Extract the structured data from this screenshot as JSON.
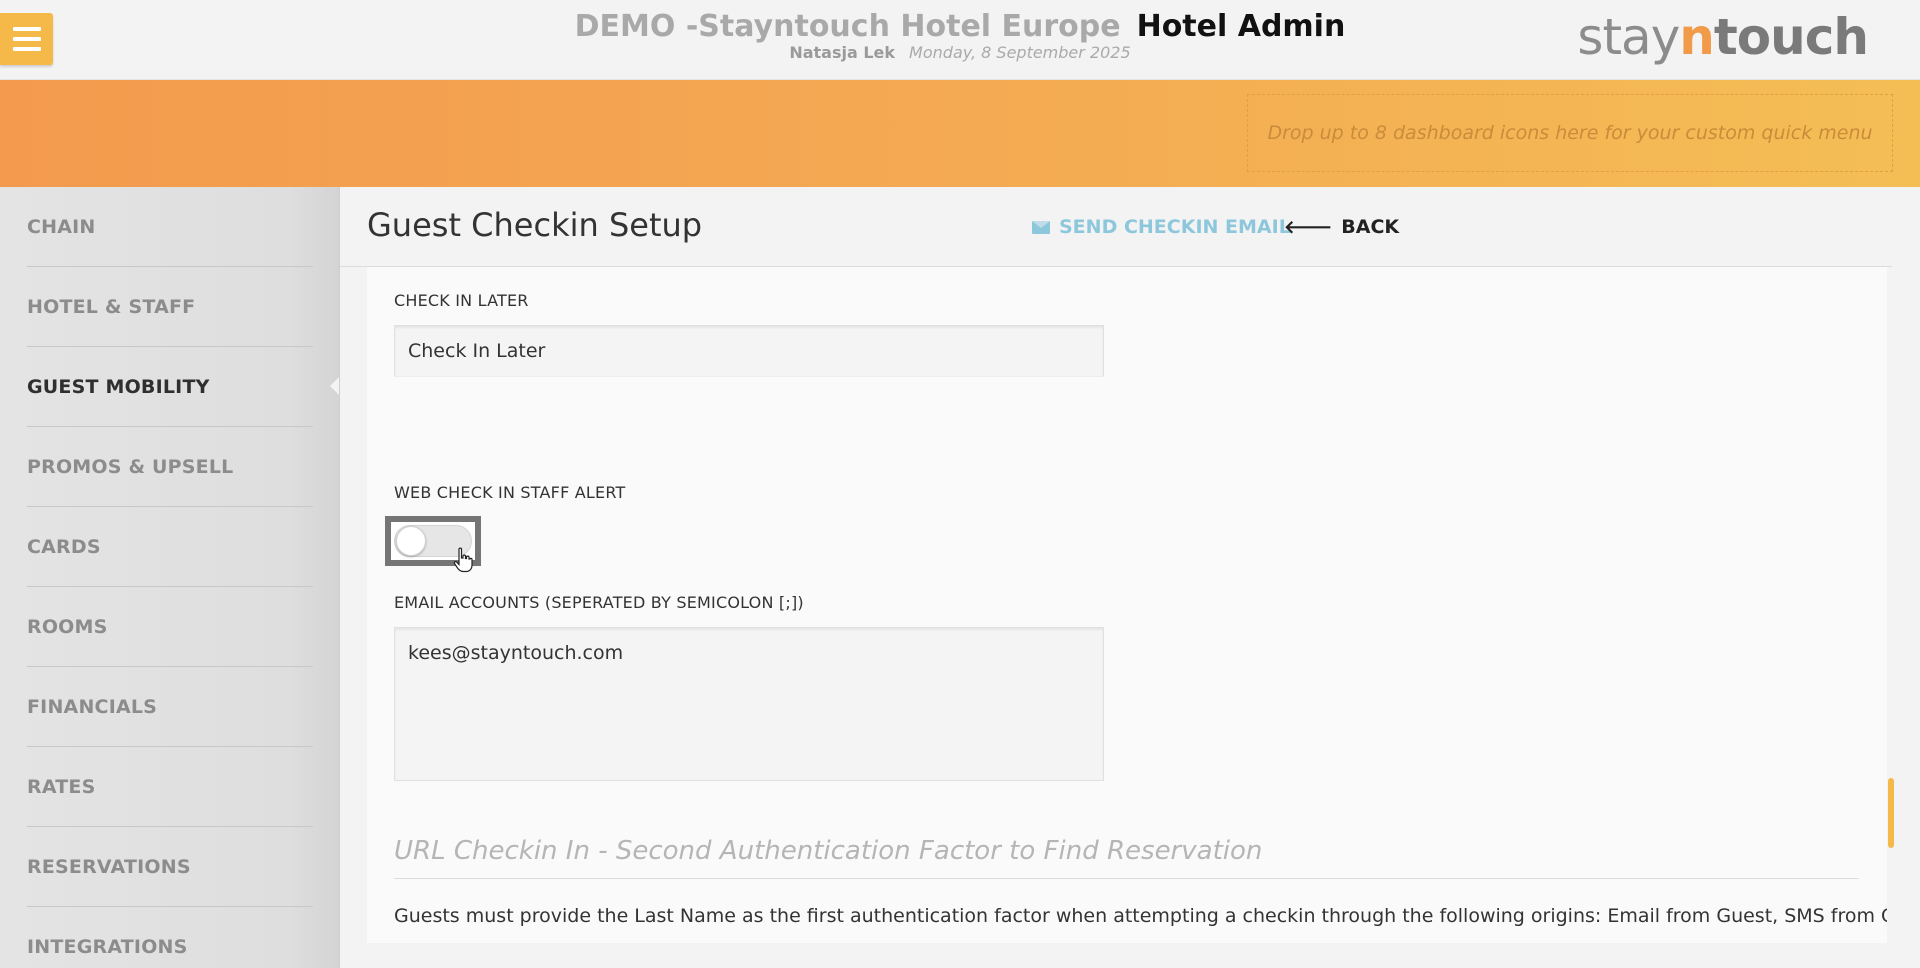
{
  "header": {
    "hotel_name": "DEMO -Stayntouch Hotel Europe",
    "app_name": "Hotel Admin",
    "user_name": "Natasja Lek",
    "date": "Monday, 8 September 2025",
    "logo": {
      "part1": "stay",
      "part2": "n",
      "part3": "touch"
    }
  },
  "banner": {
    "dropzone_text": "Drop up to 8 dashboard icons here for your custom quick menu"
  },
  "sidebar": {
    "items": [
      {
        "label": "CHAIN"
      },
      {
        "label": "HOTEL & STAFF"
      },
      {
        "label": "GUEST MOBILITY",
        "active": true
      },
      {
        "label": "PROMOS & UPSELL"
      },
      {
        "label": "CARDS"
      },
      {
        "label": "ROOMS"
      },
      {
        "label": "FINANCIALS"
      },
      {
        "label": "RATES"
      },
      {
        "label": "RESERVATIONS"
      },
      {
        "label": "INTEGRATIONS"
      }
    ]
  },
  "page": {
    "title": "Guest Checkin Setup",
    "send_email_label": "SEND CHECKIN EMAIL",
    "back_label": "BACK"
  },
  "form": {
    "check_in_later_label": "CHECK IN LATER",
    "check_in_later_value": "Check In Later",
    "staff_alert_label": "WEB CHECK IN STAFF ALERT",
    "staff_alert_on": false,
    "email_accounts_label": "EMAIL ACCOUNTS (SEPERATED BY SEMICOLON [;])",
    "email_accounts_value": "kees@stayntouch.com"
  },
  "section": {
    "title": "URL Checkin In - Second Authentication Factor to Find Reservation",
    "description": "Guests must provide the Last Name as the first authentication factor when attempting a checkin through the following origins: Email from Guest, SMS from Guest,"
  },
  "colors": {
    "accent": "#f5b94a",
    "banner_start": "#f39a4e",
    "banner_end": "#f4be55",
    "link": "#8dc7dc"
  }
}
